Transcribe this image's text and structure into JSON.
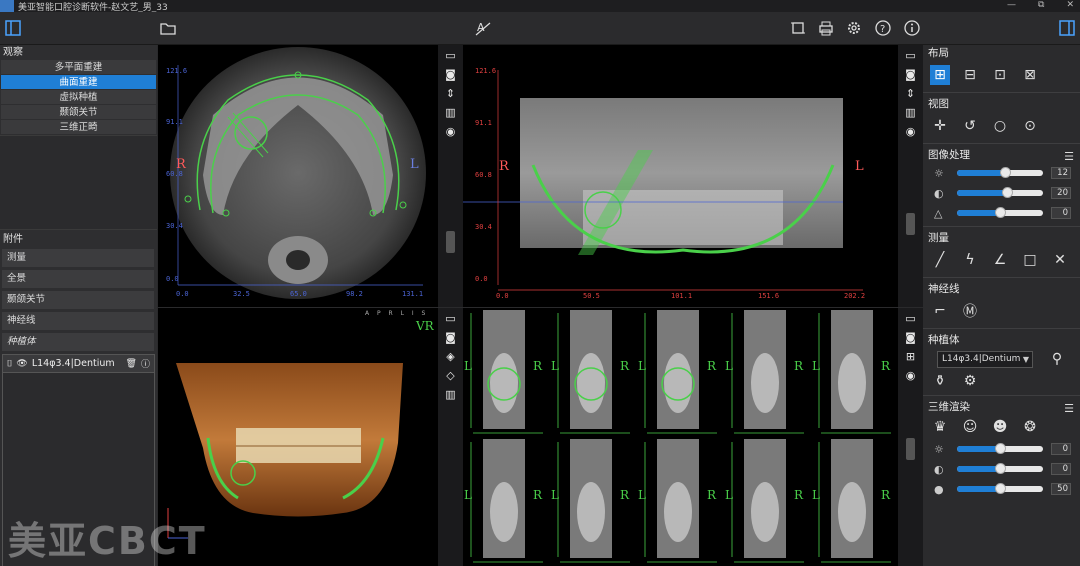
{
  "window": {
    "title": "美亚智能口腔诊断软件-赵文艺_男_33",
    "controls": [
      "—",
      "⧉",
      "✕"
    ]
  },
  "left_panel": {
    "observe_title": "观察",
    "observe_items": [
      "多平面重建",
      "曲面重建",
      "虚拟种植",
      "颞颌关节",
      "三维正畸"
    ],
    "active_index": 1,
    "attachment_title": "附件",
    "attachment_items": [
      "测量",
      "全景",
      "颞颌关节",
      "神经线",
      "种植体"
    ],
    "implant_entry": "L14φ3.4|Dentium"
  },
  "viewports": {
    "axial": {
      "left_label": "R",
      "right_label": "L",
      "y_ticks": [
        "121.6",
        "91.1",
        "60.8",
        "30.4",
        "0.0"
      ],
      "x_ticks": [
        "0.0",
        "32.5",
        "65.0",
        "98.2",
        "131.1"
      ]
    },
    "panoramic": {
      "left_label": "R",
      "right_label": "L",
      "y_ticks": [
        "121.6",
        "91.1",
        "60.8",
        "30.4",
        "0.0"
      ],
      "x_ticks": [
        "0.0",
        "50.5",
        "101.1",
        "151.6",
        "202.2"
      ]
    },
    "volume": {
      "label": "VR",
      "orientation": "A P R L I S"
    },
    "cross_sections": {
      "side_labels": [
        "R",
        "L"
      ]
    }
  },
  "right_panel": {
    "layout_title": "布局",
    "view_title": "视图",
    "image_processing_title": "图像处理",
    "image_sliders": [
      {
        "icon": "☼",
        "value": "12",
        "fraction": 0.56
      },
      {
        "icon": "◐",
        "value": "20",
        "fraction": 0.58
      },
      {
        "icon": "△",
        "value": "0",
        "fraction": 0.5
      }
    ],
    "measure_title": "测量",
    "nerve_title": "神经线",
    "implant_title": "种植体",
    "implant_select": "L14φ3.4|Dentium",
    "render3d_title": "三维渲染",
    "render_sliders": [
      {
        "icon": "☼",
        "value": "0",
        "fraction": 0.5
      },
      {
        "icon": "◐",
        "value": "0",
        "fraction": 0.5
      },
      {
        "icon": "●",
        "value": "50",
        "fraction": 0.5
      }
    ]
  },
  "watermark": "美亚CBCT",
  "colors": {
    "accent": "#1f7fd6",
    "overlay": "#4ad04a",
    "axis_red": "#e04040"
  }
}
